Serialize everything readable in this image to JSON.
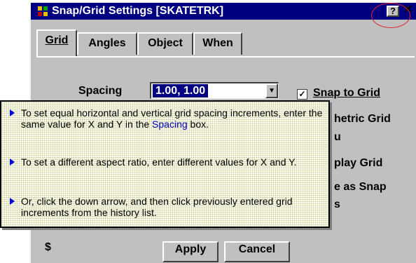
{
  "window": {
    "title": "Snap/Grid Settings [SKATETRK]",
    "help_label": "?",
    "close_label": "✕"
  },
  "tabs": [
    {
      "label": "Grid",
      "active": true
    },
    {
      "label": "Angles"
    },
    {
      "label": "Object"
    },
    {
      "label": "When"
    }
  ],
  "spacing": {
    "label": "Spacing",
    "value": "1.00, 1.00",
    "arrow": "▼"
  },
  "options": {
    "snap_to_grid_label": "Snap to Grid",
    "snap_to_grid_checked": "✓",
    "isometric_partial": "hetric Grid",
    "row3_partial": "u",
    "display_grid_partial": "play Grid",
    "same_as_snap_partial": "e as Snap",
    "row6_partial": "s"
  },
  "buttons": {
    "apply_label": "Apply",
    "cancel_label": "Cancel",
    "left_partial": "$"
  },
  "tooltip": {
    "item1_a": "To set equal horizontal and vertical grid spacing increments, enter the same value for X and Y in the ",
    "item1_link": "Spacing",
    "item1_b": " box.",
    "item2": "To set a different aspect ratio, enter different values for X and Y.",
    "item3": "Or, click the down arrow, and then click previously entered grid increments from the history list."
  },
  "colors": {
    "titlebar": "#000080",
    "dialog_face": "#c0c0c0",
    "tooltip_bg": "#fffff0",
    "annotation_circle": "#e0242c"
  }
}
